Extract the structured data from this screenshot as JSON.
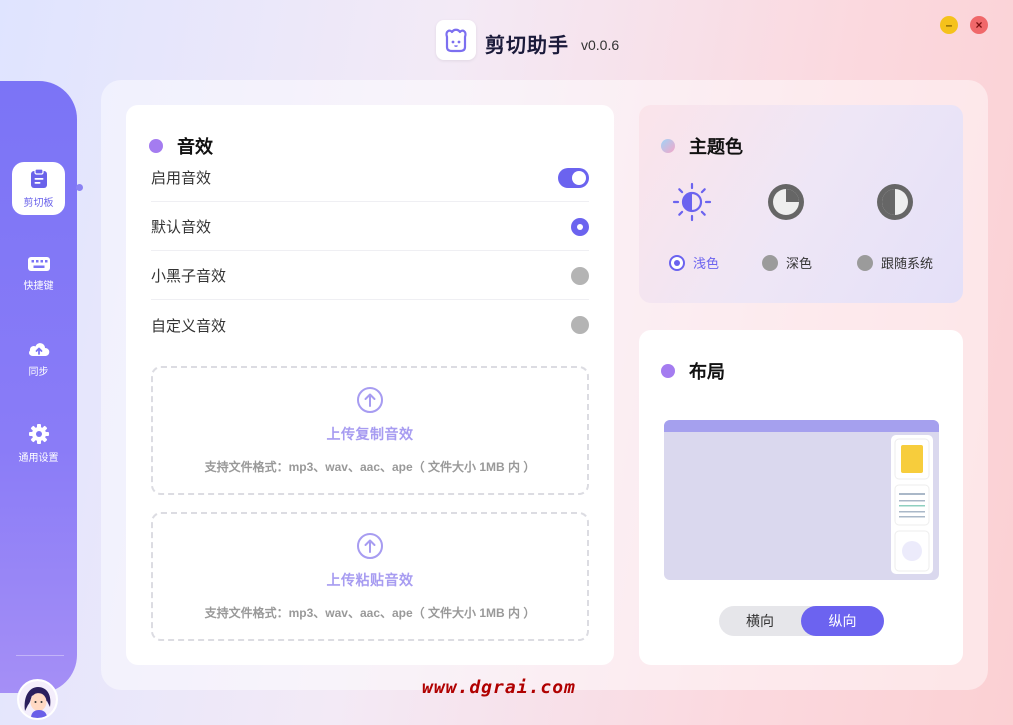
{
  "app": {
    "title": "剪切助手",
    "version": "v0.0.6"
  },
  "window_controls": {
    "minimize": "–",
    "close": "×"
  },
  "sidebar": {
    "items": [
      {
        "label": "剪切板",
        "icon": "clipboard-icon",
        "active": true
      },
      {
        "label": "快捷键",
        "icon": "keyboard-icon",
        "active": false
      },
      {
        "label": "同步",
        "icon": "cloud-upload-icon",
        "active": false
      },
      {
        "label": "通用设置",
        "icon": "gear-icon",
        "active": false
      }
    ]
  },
  "sound": {
    "title": "音效",
    "rows": [
      {
        "label": "启用音效",
        "control": "toggle",
        "on": true
      },
      {
        "label": "默认音效",
        "control": "radio",
        "selected": true
      },
      {
        "label": "小黑子音效",
        "control": "radio",
        "selected": false
      },
      {
        "label": "自定义音效",
        "control": "radio",
        "selected": false
      }
    ],
    "uploads": [
      {
        "title": "上传复制音效",
        "hint": "支持文件格式：mp3、wav、aac、ape（ 文件大小 1MB 内 ）"
      },
      {
        "title": "上传粘贴音效",
        "hint": "支持文件格式：mp3、wav、aac、ape（ 文件大小 1MB 内 ）"
      }
    ]
  },
  "theme": {
    "title": "主题色",
    "options": [
      {
        "label": "浅色",
        "icon": "sun-icon",
        "selected": true
      },
      {
        "label": "深色",
        "icon": "dark-mode-icon",
        "selected": false
      },
      {
        "label": "跟随系统",
        "icon": "contrast-icon",
        "selected": false
      }
    ]
  },
  "layout": {
    "title": "布局",
    "options": [
      {
        "label": "横向",
        "selected": false
      },
      {
        "label": "纵向",
        "selected": true
      }
    ]
  },
  "colors": {
    "accent": "#6b63ef",
    "sidebar": "#7b74f6",
    "dot_purple": "#a47cf0",
    "dot_pink": "#f5a6c8"
  },
  "watermark": "www.dgrai.com"
}
